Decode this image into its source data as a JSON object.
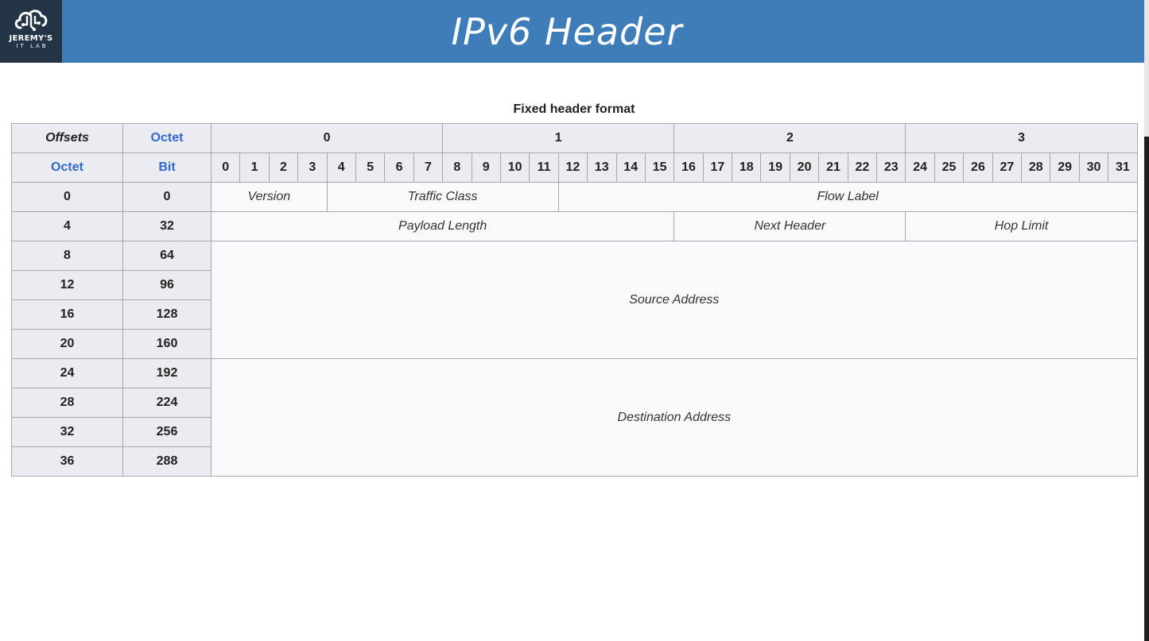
{
  "header": {
    "title": "IPv6 Header",
    "logo_line1": "JEREMY'S",
    "logo_line2": "IT LAB"
  },
  "table": {
    "caption": "Fixed header format",
    "corner_offsets": "Offsets",
    "corner_octet_top": "Octet",
    "corner_octet_left": "Octet",
    "corner_bit": "Bit",
    "octet_columns": [
      "0",
      "1",
      "2",
      "3"
    ],
    "bits": [
      "0",
      "1",
      "2",
      "3",
      "4",
      "5",
      "6",
      "7",
      "8",
      "9",
      "10",
      "11",
      "12",
      "13",
      "14",
      "15",
      "16",
      "17",
      "18",
      "19",
      "20",
      "21",
      "22",
      "23",
      "24",
      "25",
      "26",
      "27",
      "28",
      "29",
      "30",
      "31"
    ],
    "rows": [
      {
        "octet": "0",
        "bit": "0"
      },
      {
        "octet": "4",
        "bit": "32"
      },
      {
        "octet": "8",
        "bit": "64"
      },
      {
        "octet": "12",
        "bit": "96"
      },
      {
        "octet": "16",
        "bit": "128"
      },
      {
        "octet": "20",
        "bit": "160"
      },
      {
        "octet": "24",
        "bit": "192"
      },
      {
        "octet": "28",
        "bit": "224"
      },
      {
        "octet": "32",
        "bit": "256"
      },
      {
        "octet": "36",
        "bit": "288"
      }
    ],
    "fields": {
      "version": "Version",
      "traffic_class": "Traffic Class",
      "flow_label": "Flow Label",
      "payload_length": "Payload Length",
      "next_header": "Next Header",
      "hop_limit": "Hop Limit",
      "source_address": "Source Address",
      "destination_address": "Destination Address"
    }
  },
  "colors": {
    "banner": "#3f7db8",
    "logo_bg": "#243447",
    "header_cell": "#eaecf0",
    "field_cell": "#f8f9fa",
    "border": "#a2a9b1",
    "link_blue": "#3366cc"
  }
}
